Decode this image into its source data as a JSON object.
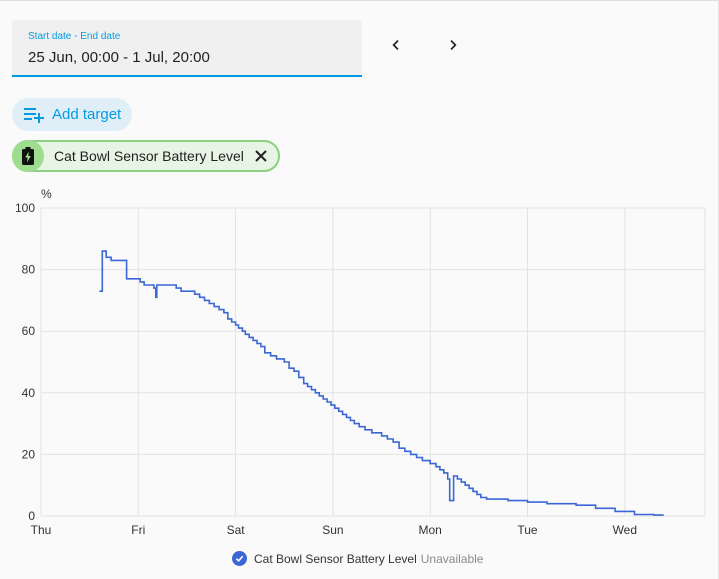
{
  "date_picker": {
    "label": "Start date - End date",
    "value": "25 Jun, 00:00 - 1 Jul, 20:00"
  },
  "nav": {
    "prev_icon": "chevron-left-icon",
    "next_icon": "chevron-right-icon"
  },
  "add_target": {
    "icon": "playlist-plus-icon",
    "label": "Add target"
  },
  "target_chip": {
    "icon": "battery-charging-icon",
    "label": "Cat Bowl Sensor Battery Level",
    "close_icon": "close-icon"
  },
  "legend": {
    "name": "Cat Bowl Sensor Battery Level",
    "state": "Unavailable"
  },
  "colors": {
    "accent": "#039be5",
    "series": "#3b67d6",
    "chip_border": "#8bd07d",
    "chip_bg": "#e8f5e4"
  },
  "chart_data": {
    "type": "line",
    "ylabel": "%",
    "ylim": [
      0,
      100
    ],
    "y_ticks": [
      0,
      20,
      40,
      60,
      80,
      100
    ],
    "x_tick_labels": [
      "Thu",
      "Fri",
      "Sat",
      "Sun",
      "Mon",
      "Tue",
      "Wed"
    ],
    "x_unit": "days",
    "xlim": [
      0,
      6.85
    ],
    "grid": true,
    "legend_placement": "bottom-center",
    "series": [
      {
        "name": "Cat Bowl Sensor Battery Level",
        "style": "step",
        "points": [
          [
            0.6,
            73
          ],
          [
            0.63,
            86
          ],
          [
            0.67,
            84
          ],
          [
            0.72,
            83
          ],
          [
            0.88,
            77
          ],
          [
            1.02,
            76
          ],
          [
            1.06,
            75
          ],
          [
            1.16,
            74
          ],
          [
            1.18,
            71
          ],
          [
            1.19,
            75
          ],
          [
            1.39,
            74
          ],
          [
            1.44,
            73
          ],
          [
            1.54,
            73
          ],
          [
            1.58,
            72
          ],
          [
            1.63,
            71
          ],
          [
            1.68,
            70
          ],
          [
            1.73,
            69
          ],
          [
            1.78,
            68
          ],
          [
            1.83,
            67
          ],
          [
            1.88,
            66
          ],
          [
            1.92,
            64
          ],
          [
            1.96,
            63
          ],
          [
            2.0,
            62
          ],
          [
            2.03,
            61
          ],
          [
            2.07,
            60
          ],
          [
            2.1,
            59
          ],
          [
            2.14,
            58
          ],
          [
            2.18,
            57
          ],
          [
            2.22,
            56
          ],
          [
            2.26,
            55
          ],
          [
            2.3,
            53
          ],
          [
            2.36,
            52
          ],
          [
            2.42,
            51
          ],
          [
            2.5,
            50
          ],
          [
            2.55,
            48
          ],
          [
            2.6,
            47
          ],
          [
            2.65,
            45
          ],
          [
            2.7,
            43
          ],
          [
            2.74,
            42
          ],
          [
            2.78,
            41
          ],
          [
            2.82,
            40
          ],
          [
            2.86,
            39
          ],
          [
            2.9,
            38
          ],
          [
            2.94,
            37
          ],
          [
            2.98,
            36
          ],
          [
            3.02,
            35
          ],
          [
            3.06,
            34
          ],
          [
            3.1,
            33
          ],
          [
            3.14,
            32
          ],
          [
            3.18,
            31
          ],
          [
            3.22,
            30
          ],
          [
            3.27,
            29
          ],
          [
            3.33,
            28
          ],
          [
            3.4,
            27
          ],
          [
            3.5,
            26
          ],
          [
            3.56,
            25
          ],
          [
            3.62,
            24
          ],
          [
            3.68,
            22
          ],
          [
            3.74,
            21
          ],
          [
            3.8,
            20
          ],
          [
            3.86,
            19
          ],
          [
            3.92,
            18
          ],
          [
            4.0,
            17
          ],
          [
            4.06,
            16
          ],
          [
            4.1,
            15
          ],
          [
            4.14,
            14
          ],
          [
            4.18,
            12
          ],
          [
            4.2,
            5
          ],
          [
            4.24,
            13
          ],
          [
            4.28,
            12
          ],
          [
            4.32,
            11
          ],
          [
            4.36,
            10
          ],
          [
            4.4,
            9
          ],
          [
            4.44,
            8
          ],
          [
            4.48,
            7
          ],
          [
            4.52,
            6
          ],
          [
            4.58,
            5.5
          ],
          [
            4.8,
            5
          ],
          [
            5.0,
            4.5
          ],
          [
            5.2,
            4
          ],
          [
            5.5,
            3.5
          ],
          [
            5.7,
            2.5
          ],
          [
            5.9,
            1.5
          ],
          [
            6.1,
            0.5
          ],
          [
            6.3,
            0.3
          ],
          [
            6.4,
            0.3
          ]
        ]
      }
    ]
  }
}
